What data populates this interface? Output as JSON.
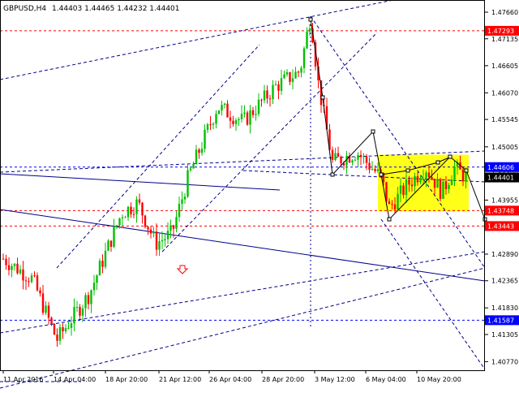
{
  "header": {
    "symbol": "GBPUSD,H4",
    "quote": "1.44403 1.44465 1.44232 1.44401"
  },
  "price_scale": [
    "1.47660",
    "1.47135",
    "1.46605",
    "1.46070",
    "1.45545",
    "1.45005",
    "1.44480",
    "1.43955",
    "1.43425",
    "1.42890",
    "1.42365",
    "1.41830",
    "1.41305",
    "1.40770"
  ],
  "price_tags": [
    {
      "text": "1.47293",
      "color": "#ff0000"
    },
    {
      "text": "1.44606",
      "color": "#0000ff"
    },
    {
      "text": "1.44401",
      "color": "#000000"
    },
    {
      "text": "1.43748",
      "color": "#ff0000"
    },
    {
      "text": "1.43443",
      "color": "#ff0000"
    },
    {
      "text": "1.41587",
      "color": "#0000ff"
    }
  ],
  "time_labels": [
    "11 Apr 2016",
    "14 Apr 04:00",
    "18 Apr 20:00",
    "21 Apr 12:00",
    "26 Apr 04:00",
    "28 Apr 20:00",
    "3 May 12:00",
    "6 May 04:00",
    "10 May 20:00"
  ],
  "chart_data": {
    "type": "candlestick",
    "symbol": "GBPUSD",
    "timeframe": "H4",
    "ylim": [
      1.406,
      1.479
    ],
    "candles": [],
    "levels": [
      {
        "price": 1.47293,
        "color": "#ff0000",
        "style": "dashed"
      },
      {
        "price": 1.44606,
        "color": "#0000ff",
        "style": "dashed"
      },
      {
        "price": 1.43748,
        "color": "#ff0000",
        "style": "dashed"
      },
      {
        "price": 1.43443,
        "color": "#ff0000",
        "style": "dashed"
      },
      {
        "price": 1.41587,
        "color": "#0000ff",
        "style": "dashed"
      }
    ],
    "colors": {
      "bull": "#00c000",
      "bear": "#ff0000",
      "trend": "#00008b",
      "rect": "#ffff00"
    }
  }
}
